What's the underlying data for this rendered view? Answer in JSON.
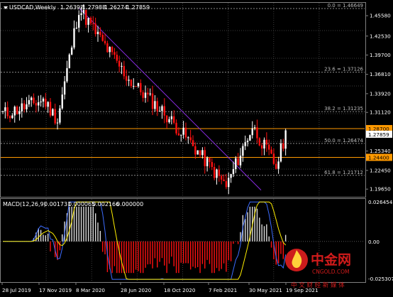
{
  "header": {
    "symbol": "USDCAD,Weekly",
    "open": "1.26392",
    "high": "1.27988",
    "low": "1.26274",
    "close": "1.27859"
  },
  "macd_header": {
    "label": "MACD(12,26,9)",
    "v1": "0.001731",
    "v2": "0.000065",
    "v3": "0.002166",
    "v4": "0.000000"
  },
  "fib_levels": [
    {
      "label": "0.0 = 1.46649",
      "value": 1.46649
    },
    {
      "label": "23.6 = 1.37126",
      "value": 1.37126
    },
    {
      "label": "38.2 = 1.31235",
      "value": 1.31235
    },
    {
      "label": "50.0 = 1.26474",
      "value": 1.26474
    },
    {
      "label": "61.8 = 1.21712",
      "value": 1.21712
    }
  ],
  "price_axis_labels": [
    "1.45580",
    "1.42530",
    "1.39700",
    "1.36810",
    "1.33920",
    "1.31120",
    "1.28230",
    "1.25340",
    "1.22450",
    "1.19650"
  ],
  "price_flags": {
    "resistance": "1.28700",
    "current": "1.27859",
    "support": "1.24400"
  },
  "macd_axis_labels": {
    "top": "0.026454",
    "zero": "0.00",
    "bottom": "-0.025307"
  },
  "time_axis_labels": [
    "28 Jul 2019",
    "17 Nov 2019",
    "8 Mar 2020",
    "28 Jun 2020",
    "18 Oct 2020",
    "7 Feb 2021",
    "30 May 2021",
    "19 Sep 2021"
  ],
  "watermark": {
    "brand": "中金网",
    "domain": "CNGOLD.COM",
    "tagline": "中 文 财 经 新 媒 体"
  },
  "colors": {
    "bull": "#ffffff",
    "bear": "#ff1111",
    "resistance_line": "#ff9900",
    "trend_line": "#8a2be2",
    "macd_main": "#3c6cff",
    "macd_signal": "#ffee00",
    "grid": "#3c3c3c",
    "fib": "#8a8a8a",
    "watermark": "#d11b1b"
  },
  "chart_data": {
    "type": "candlestick",
    "symbol": "USDCAD",
    "timeframe": "Weekly",
    "y_range": [
      1.185,
      1.475
    ],
    "key_points": [
      {
        "date": "Jul 2019",
        "price": 1.31
      },
      {
        "date": "Nov 2019",
        "price": 1.33
      },
      {
        "date": "Jan 2020",
        "price": 1.3
      },
      {
        "date": "Mar 2020",
        "price": 1.4665
      },
      {
        "date": "Jun 2020",
        "price": 1.36
      },
      {
        "date": "Oct 2020",
        "price": 1.31
      },
      {
        "date": "Jan 2021",
        "price": 1.27
      },
      {
        "date": "May 2021",
        "price": 1.2007
      },
      {
        "date": "Aug 2021",
        "price": 1.29
      },
      {
        "date": "Oct 2021",
        "price": 1.23
      },
      {
        "date": "Nov 2021",
        "price": 1.2786
      }
    ],
    "macd": {
      "main": 0.001731,
      "signal": 6.5e-05,
      "histogram": 0.002166,
      "range": [
        -0.025307,
        0.026454
      ]
    }
  }
}
